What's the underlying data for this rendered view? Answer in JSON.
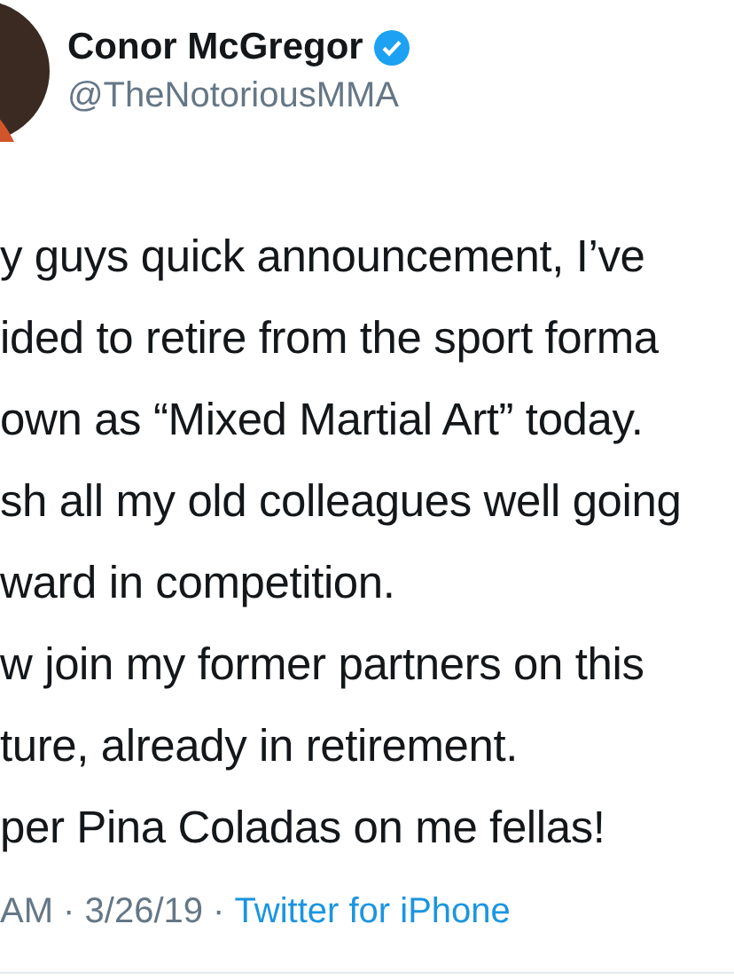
{
  "author": {
    "name": "Conor McGregor",
    "verified": true,
    "handle": "@TheNotoriousMMA"
  },
  "tweet_lines": [
    "y guys quick announcement, I’ve",
    "ided to retire from the sport forma",
    "own as “Mixed Martial Art” today.",
    "sh all my old colleagues well going",
    "ward in competition.",
    "w join my former partners on this",
    "ture, already in retirement.",
    "per Pina Coladas on me fellas!"
  ],
  "meta": {
    "time_date": "AM · 3/26/19 · ",
    "source": "Twitter for iPhone"
  }
}
